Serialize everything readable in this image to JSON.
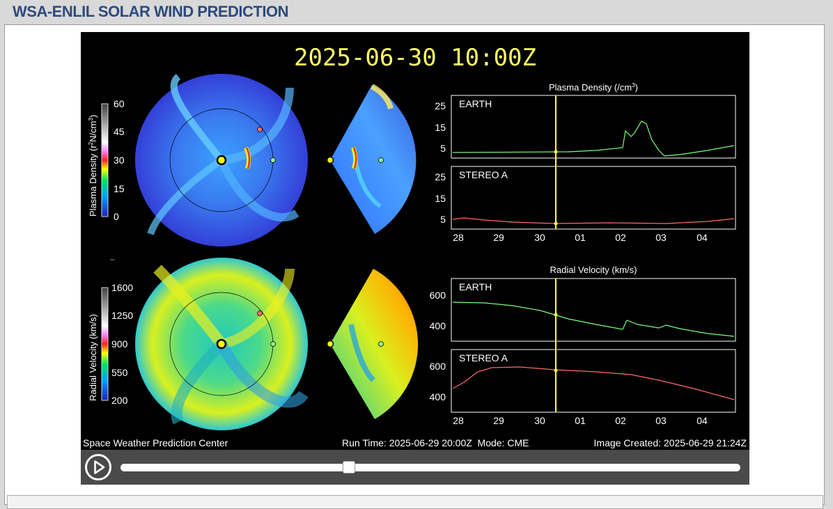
{
  "page": {
    "title": "WSA-ENLIL SOLAR WIND PREDICTION"
  },
  "viz": {
    "timestamp": "2025-06-30 10:00Z",
    "density_colorbar": {
      "label": "Plasma Density (r",
      "label_sup1": "2",
      "label_mid": "N/cm",
      "label_sup2": "3",
      "label_end": ")",
      "ticks": [
        "60",
        "45",
        "30",
        "15",
        "0"
      ]
    },
    "velocity_colorbar": {
      "label": "Radial Velocity (km/s)",
      "ticks": [
        "1600",
        "1250",
        "900",
        "550",
        "200"
      ]
    },
    "density_plot": {
      "title": "Plasma Density (/cm",
      "title_sup": "3",
      "title_end": ")",
      "earth_label": "EARTH",
      "stereo_label": "STEREO A",
      "y_ticks": [
        "25",
        "15",
        "5"
      ]
    },
    "velocity_plot": {
      "title": "Radial Velocity (km/s)",
      "earth_label": "EARTH",
      "stereo_label": "STEREO A",
      "y_ticks": [
        "600",
        "400"
      ]
    },
    "x_ticks": [
      "28",
      "29",
      "30",
      "01",
      "02",
      "03",
      "04"
    ],
    "footer": {
      "left": "Space Weather Prediction Center",
      "middle": "Run Time: 2025-06-29 20:00Z  Mode: CME",
      "right": "Image Created: 2025-06-29 21:24Z"
    },
    "colors": {
      "earth_line": "#7CFC7C",
      "stereo_line": "#ff6b6b",
      "cursor": "#ffff33",
      "title_text": "#ffff66"
    }
  },
  "player": {
    "progress": 0.37,
    "play_icon": "play-icon"
  }
}
